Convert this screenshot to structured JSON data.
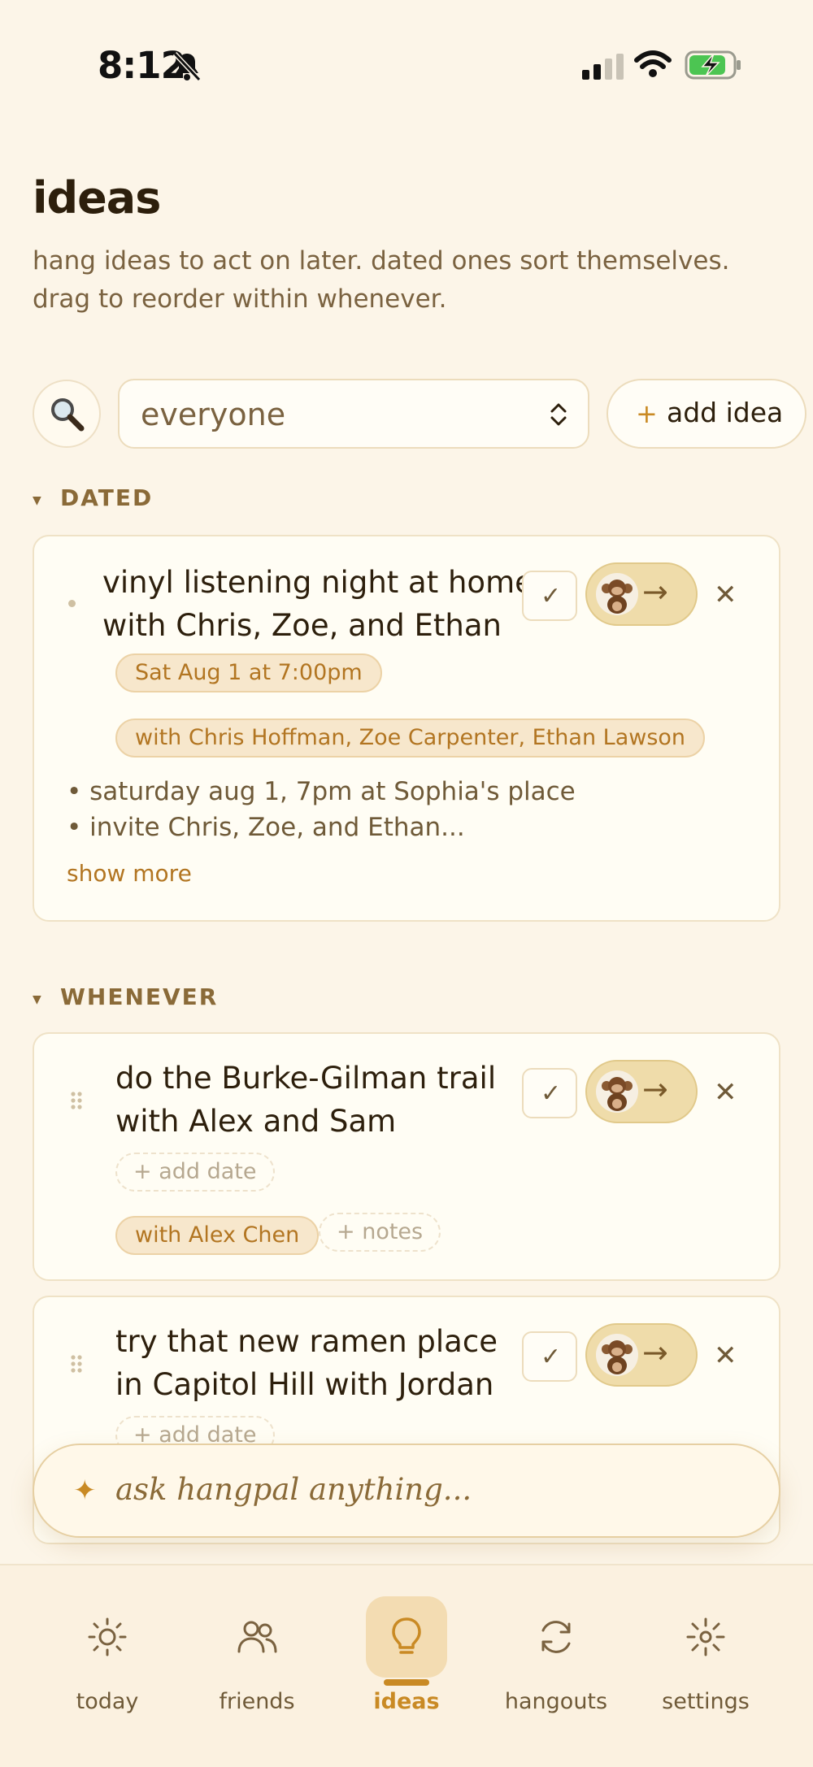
{
  "status_bar": {
    "time": "8:12"
  },
  "header": {
    "title": "ideas",
    "subtitle": "hang ideas to act on later. dated ones sort themselves. drag to reorder within whenever."
  },
  "toolbar": {
    "filter_value": "everyone",
    "add_plus": "+",
    "add_label": "add idea"
  },
  "sections": {
    "dated": {
      "label": "DATED",
      "cards": [
        {
          "title_line1": "vinyl listening night at home",
          "title_line2": "with Chris, Zoe, and Ethan",
          "date_pill": "Sat Aug 1 at 7:00pm",
          "people_pill": "with Chris Hoffman, Zoe Carpenter, Ethan Lawson",
          "notes": [
            "• saturday aug 1, 7pm at Sophia's place",
            "• invite Chris, Zoe, and Ethan..."
          ],
          "show_more": "show more"
        }
      ]
    },
    "whenever": {
      "label": "WHENEVER",
      "cards": [
        {
          "title_line1": "do the Burke-Gilman trail",
          "title_line2": "with Alex and Sam",
          "add_date": "+ add date",
          "people_pill": "with Alex Chen",
          "add_notes": "+ notes"
        },
        {
          "title_line1": "try that new ramen place",
          "title_line2": "in Capitol Hill with Jordan",
          "add_date": "+ add date"
        }
      ]
    }
  },
  "card_actions": {
    "check": "✓",
    "arrow": "→",
    "close": "✕"
  },
  "ask_bar": {
    "icon": "✦",
    "placeholder": "ask hangpal anything..."
  },
  "tab_bar": {
    "items": [
      {
        "label": "today",
        "icon": "sun-icon",
        "active": false
      },
      {
        "label": "friends",
        "icon": "people-icon",
        "active": false
      },
      {
        "label": "ideas",
        "icon": "lightbulb-icon",
        "active": true
      },
      {
        "label": "hangouts",
        "icon": "refresh-icon",
        "active": false
      },
      {
        "label": "settings",
        "icon": "gear-icon",
        "active": false
      }
    ]
  },
  "colors": {
    "background": "#fcf5e8",
    "accent": "#c98a24",
    "card": "#fffdf4",
    "pill": "#f7e7cc",
    "text": "#2d1f0c",
    "muted": "#7a6240"
  }
}
